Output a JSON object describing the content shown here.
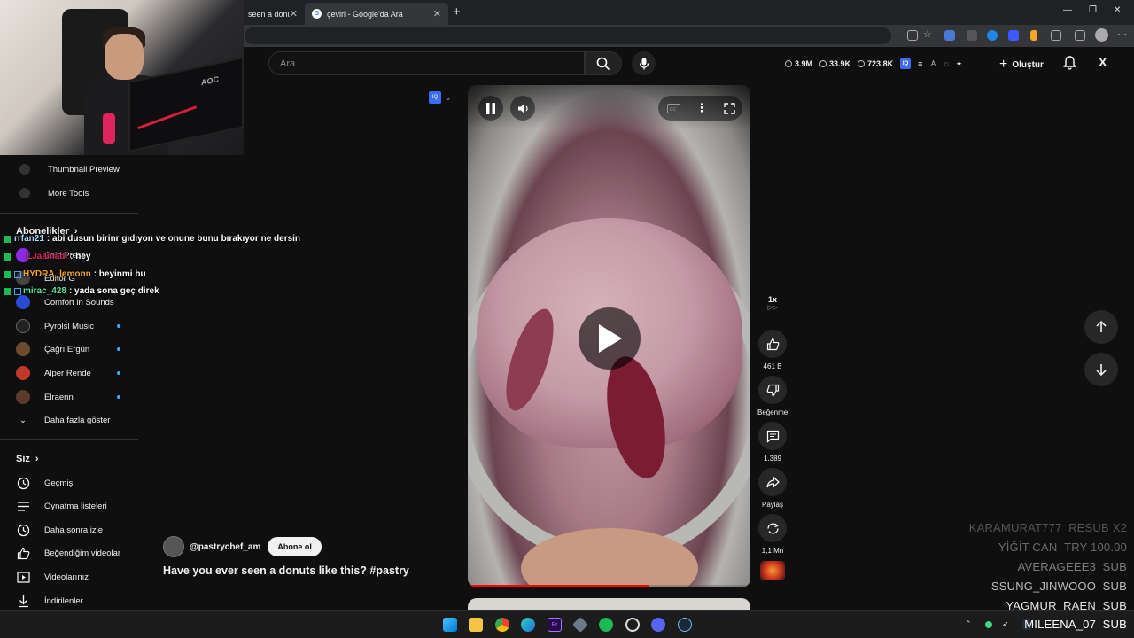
{
  "browser": {
    "tabs": [
      {
        "title": "seen a donuts"
      },
      {
        "title": "çeviri - Google'da Ara"
      }
    ]
  },
  "youtube": {
    "search_placeholder": "Ara",
    "stats": [
      "3.9M",
      "33.9K",
      "723.8K"
    ],
    "create_label": "Oluştur"
  },
  "sidebar": {
    "tools": [
      {
        "label": "Thumbnail Preview"
      },
      {
        "label": "More Tools"
      }
    ],
    "subscriptions_title": "Abonelikler",
    "subscriptions": [
      {
        "label": "Cold Press",
        "avatar_color": "#8a2be2"
      },
      {
        "label": "Editor G",
        "avatar_color": "#444444"
      },
      {
        "label": "Comfort in Sounds",
        "avatar_color": "#2a4bd7"
      },
      {
        "label": "Pyrolsl Music",
        "avatar_color": "#222222"
      },
      {
        "label": "Çağrı Ergün",
        "avatar_color": "#6b4a2e"
      },
      {
        "label": "Alper Rende",
        "avatar_color": "#c0392b"
      },
      {
        "label": "Elraenn",
        "avatar_color": "#5a3b2b"
      }
    ],
    "show_more": "Daha fazla göster",
    "you_title": "Siz",
    "you_items": [
      {
        "label": "Geçmiş",
        "icon": "history-icon"
      },
      {
        "label": "Oynatma listeleri",
        "icon": "playlists-icon"
      },
      {
        "label": "Daha sonra izle",
        "icon": "clock-icon"
      },
      {
        "label": "Beğendiğim videolar",
        "icon": "thumbs-up-icon"
      },
      {
        "label": "Videolarınız",
        "icon": "video-icon"
      },
      {
        "label": "İndirilenler",
        "icon": "download-icon"
      }
    ]
  },
  "chat": [
    {
      "user": "rrfan21",
      "user_color": "#a8d8ff",
      "message": ": abi dusun birinr gıdıyon ve onune bunu bırakıyor ne dersin"
    },
    {
      "user": "LJaamadi",
      "user_color": "#e0245e",
      "message": ": hey"
    },
    {
      "user": "HYDRA_lemonn",
      "user_color": "#f5a623",
      "message": ": beyinmi bu"
    },
    {
      "user": "mirac_428",
      "user_color": "#56e39f",
      "message": ": yada sona geç direk"
    }
  ],
  "video": {
    "channel": "@pastrychef_am",
    "subscribe_label": "Abone ol",
    "title": "Have you ever seen a donuts like this? #pastry",
    "progress": 0.64
  },
  "actions": {
    "speed": "1x",
    "likes": "461 B",
    "dislike_label": "Beğenme",
    "comments": "1.389",
    "share_label": "Paylaş",
    "remix_count": "1,1 Mn"
  },
  "subs_feed": [
    {
      "name": "KARAMURAT777",
      "action": "RESUB X2",
      "color": "#555555"
    },
    {
      "name": "YİĞİT CAN",
      "action": "TRY 100.00",
      "color": "#6a6a6a"
    },
    {
      "name": "AVERAGEEE3",
      "action": "SUB",
      "color": "#7d7d7d"
    },
    {
      "name": "SSUNG_JINWOOO",
      "action": "SUB",
      "color": "#bdbdbd"
    },
    {
      "name": "YAGMUR_RAEN",
      "action": "SUB",
      "color": "#e6e6e6"
    },
    {
      "name": "MILEENA_07",
      "action": "SUB",
      "color": "#ffffff"
    }
  ]
}
